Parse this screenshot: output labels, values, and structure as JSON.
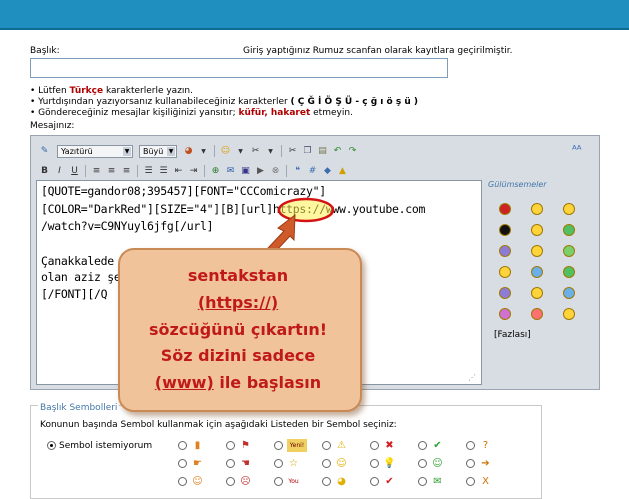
{
  "form": {
    "title_label": "Başlık:",
    "note": "Giriş yaptığınız Rumuz scanfan olarak kayıtlara geçirilmiştir.",
    "title_value": ""
  },
  "bullets": [
    {
      "pre": "Lütfen ",
      "em": "Türkçe",
      "post": " karakterlerle yazın."
    },
    {
      "pre": "Yurtdışından yazıyorsanız kullanabileceğiniz karakterler ",
      "em": "( Ç Ğ İ Ö Ş Ü - ç ğ ı ö ş ü )",
      "post": ""
    },
    {
      "pre": "Göndereceğiniz mesajlar kişiliğinizi yansıtır; ",
      "em": "küfür, hakaret",
      "post": " etmeyin."
    }
  ],
  "message_label": "Mesajınız:",
  "editor": {
    "font_select": "Yazıtürü",
    "size_select": "Büyü",
    "content_lines": [
      "[QUOTE=gandor08;395457][FONT=\"CCComicrazy\"]",
      "[COLOR=\"DarkRed\"][SIZE=\"4\"][B][url]https://www.youtube.com",
      "/watch?v=C9NYuyl6jfg[/url]",
      "",
      "Çanakkalede                                   feda ederek şehit",
      "olan aziz şe                                  ][/COLOR]",
      "[/FONT][/Q"
    ],
    "highlight_text": "https:/"
  },
  "smilies": {
    "title": "Gülümsemeler",
    "more_link": "[Fazlası]",
    "icons": [
      "flag",
      "grin",
      "smile",
      "devil",
      "grin",
      "cool",
      "frown",
      "dizzy",
      "alien",
      "embarrassed",
      "wink",
      "cool",
      "frown",
      "confused",
      "wink",
      "worried",
      "angry",
      "grin"
    ]
  },
  "callout": {
    "line1": "sentakstan",
    "line2": "(https://)",
    "line3": "sözcüğünü çıkartın!",
    "line4": "Söz dizini sadece",
    "line5_u": "(www)",
    "line5_rest": " ile başlasın"
  },
  "sembol": {
    "title": "Başlık Sembolleri",
    "instruction": "Konunun başında Sembol kullanmak için aşağıdaki Listeden bir Sembol seçiniz:",
    "none_label": "Sembol istemiyorum",
    "badge": "Yeni!",
    "badge2": "You"
  }
}
